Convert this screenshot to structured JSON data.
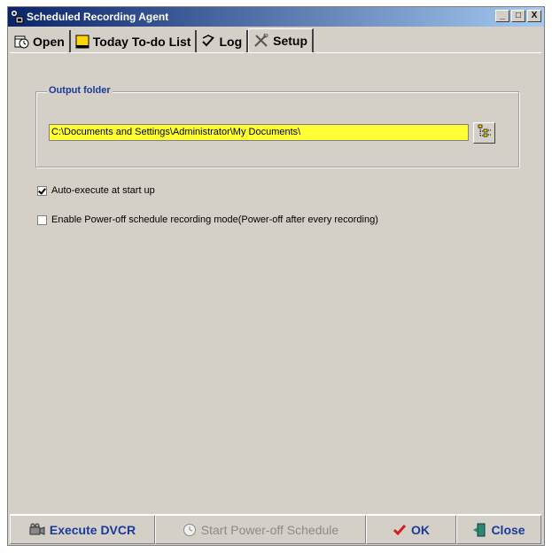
{
  "window": {
    "title": "Scheduled Recording Agent",
    "buttons": {
      "minimize": "_",
      "maximize": "□",
      "close": "X"
    }
  },
  "tabs": [
    {
      "label": "Open",
      "icon": "clock-calendar-icon"
    },
    {
      "label": "Today To-do List",
      "icon": "yellow-note-icon"
    },
    {
      "label": "Log",
      "icon": "log-check-icon"
    },
    {
      "label": "Setup",
      "icon": "tools-icon",
      "active": true
    }
  ],
  "setup": {
    "output_folder": {
      "legend": "Output folder",
      "path": "C:\\Documents and Settings\\Administrator\\My Documents\\",
      "browse_icon": "folder-tree-icon"
    },
    "auto_execute": {
      "label": "Auto-execute at start up",
      "checked": true
    },
    "power_off_mode": {
      "label": "Enable Power-off schedule recording mode(Power-off after every recording)",
      "checked": false
    }
  },
  "footer": {
    "execute": {
      "label": "Execute DVCR",
      "icon": "camera-icon"
    },
    "start_power_off": {
      "label": "Start Power-off Schedule",
      "icon": "clock-icon",
      "enabled": false
    },
    "ok": {
      "label": "OK",
      "icon": "checkmark-icon"
    },
    "close": {
      "label": "Close",
      "icon": "exit-door-icon"
    }
  },
  "colors": {
    "titlebar_start": "#0a246a",
    "titlebar_end": "#a6caf0",
    "path_field_bg": "#ffff33",
    "button_text": "#1a3a9a",
    "window_bg": "#d4d0c8"
  }
}
